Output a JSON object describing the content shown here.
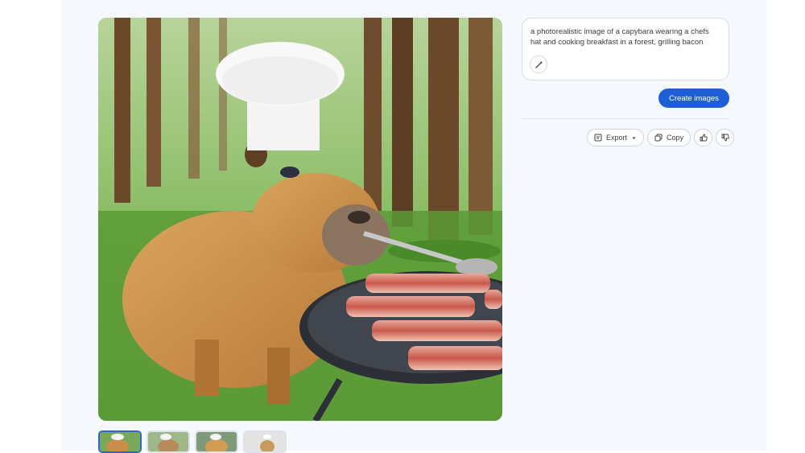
{
  "prompt": {
    "text": "a photorealistic image of a capybara wearing a chefs hat and cooking breakfast in a forest, grilling bacon",
    "magic_icon": "wand-icon"
  },
  "create_button": {
    "label": "Create images"
  },
  "actions": {
    "export_label": "Export",
    "copy_label": "Copy",
    "thumbs_up_icon": "thumbs-up-icon",
    "thumbs_down_icon": "thumbs-down-icon"
  },
  "image": {
    "description": "capybara chef grilling bacon in forest",
    "thumbnail_count": 4,
    "selected_thumbnail": 1
  },
  "colors": {
    "accent": "#1f5fd6",
    "background": "#f5f8fc",
    "selected_border": "#3366cc"
  }
}
